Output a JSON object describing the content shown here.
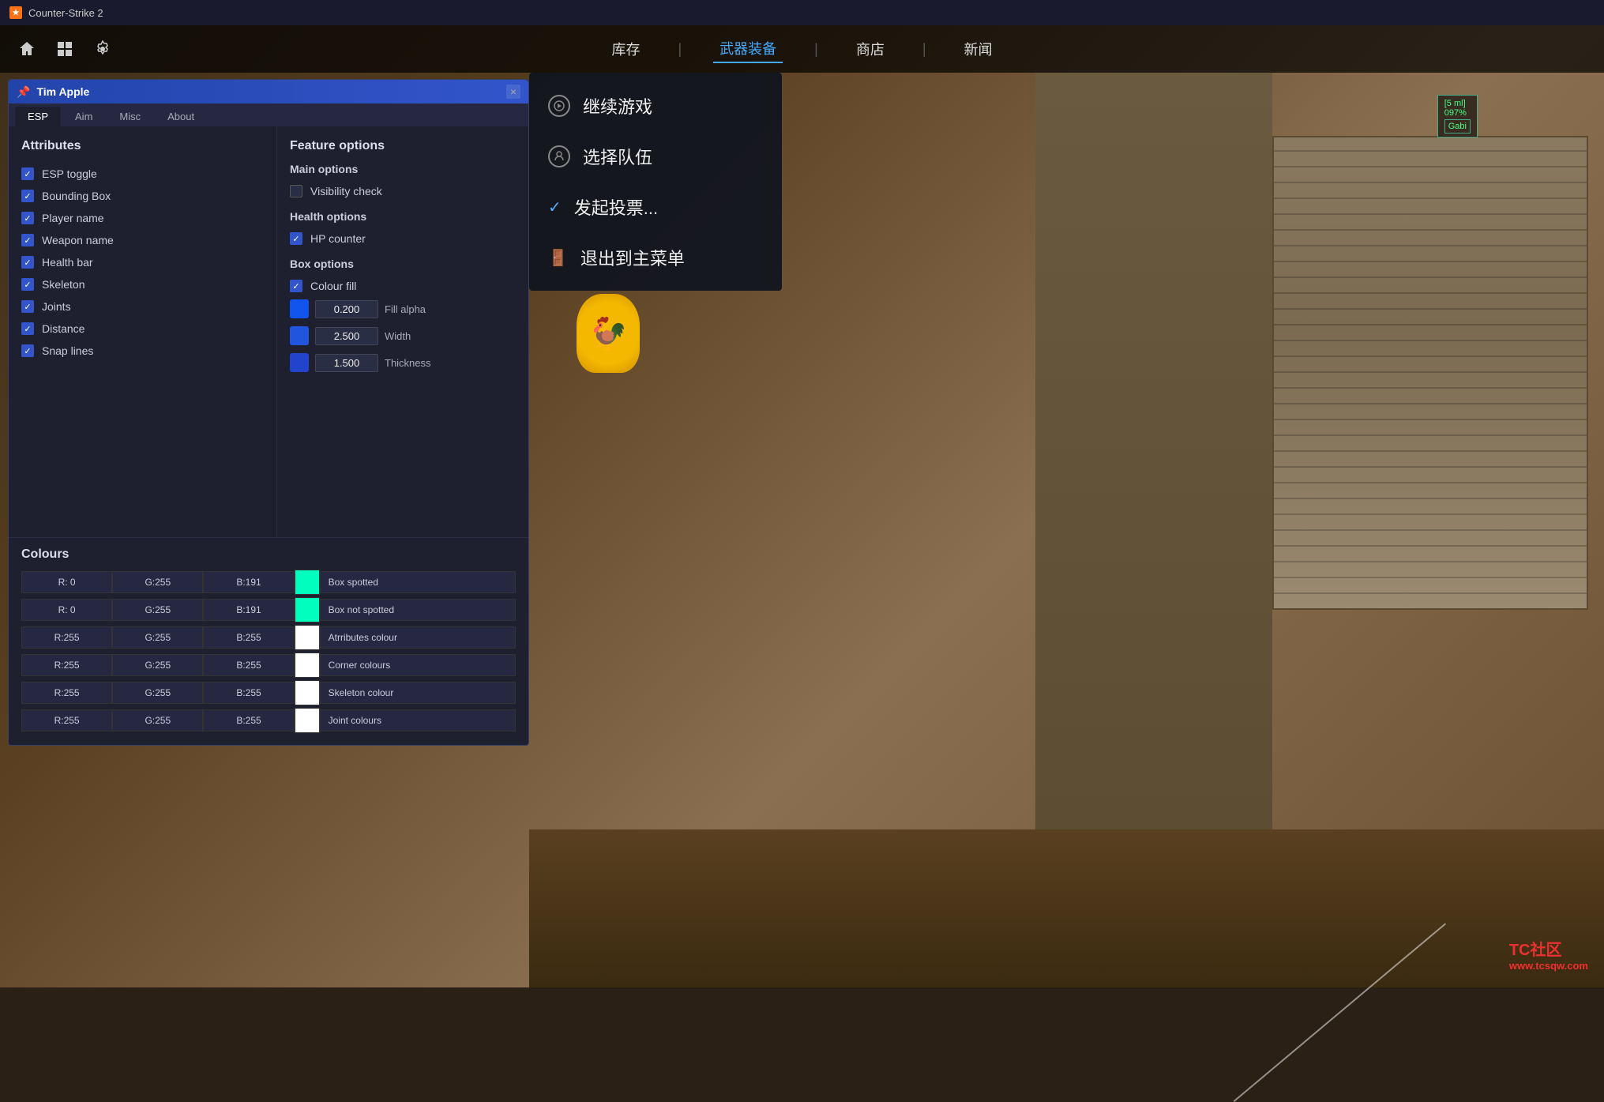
{
  "titlebar": {
    "title": "Counter-Strike 2"
  },
  "topnav": {
    "home_icon": "⌂",
    "inventory_icon": "⊞",
    "gear_icon": "⚙",
    "items": [
      "库存",
      "武器装备",
      "商店",
      "新闻"
    ]
  },
  "menu": {
    "items": [
      {
        "icon": "circle",
        "text": "继续游戏"
      },
      {
        "icon": "refresh",
        "text": "选择队伍"
      },
      {
        "icon": "check",
        "text": "发起投票..."
      },
      {
        "icon": "door",
        "text": "退出到主菜单"
      }
    ]
  },
  "cheat_panel": {
    "title": "Tim Apple",
    "pin_icon": "📌",
    "close_icon": "×",
    "tabs": [
      "ESP",
      "Aim",
      "Misc",
      "About"
    ],
    "active_tab": "ESP",
    "attributes": {
      "title": "Attributes",
      "items": [
        {
          "label": "ESP toggle",
          "checked": true
        },
        {
          "label": "Bounding Box",
          "checked": true
        },
        {
          "label": "Player name",
          "checked": true
        },
        {
          "label": "Weapon name",
          "checked": true
        },
        {
          "label": "Health bar",
          "checked": true
        },
        {
          "label": "Skeleton",
          "checked": true
        },
        {
          "label": "Joints",
          "checked": true
        },
        {
          "label": "Distance",
          "checked": true
        },
        {
          "label": "Snap lines",
          "checked": true
        }
      ]
    },
    "feature_options": {
      "title": "Feature options",
      "main_options": {
        "title": "Main options",
        "visibility_check": {
          "label": "Visibility check",
          "checked": false
        }
      },
      "health_options": {
        "title": "Health options",
        "hp_counter": {
          "label": "HP counter",
          "checked": true
        }
      },
      "box_options": {
        "title": "Box options",
        "colour_fill": {
          "label": "Colour fill",
          "checked": true
        },
        "sliders": [
          {
            "color": "#1155ee",
            "value": "0.200",
            "label": "Fill alpha"
          },
          {
            "color": "#2255dd",
            "value": "2.500",
            "label": "Width"
          },
          {
            "color": "#2244cc",
            "value": "1.500",
            "label": "Thickness"
          }
        ]
      }
    },
    "colours": {
      "title": "Colours",
      "rows": [
        {
          "r": "R: 0",
          "g": "G:255",
          "b": "B:191",
          "swatch": "#00ffbf",
          "label": "Box spotted"
        },
        {
          "r": "R: 0",
          "g": "G:255",
          "b": "B:191",
          "swatch": "#00ffbf",
          "label": "Box not spotted"
        },
        {
          "r": "R:255",
          "g": "G:255",
          "b": "B:255",
          "swatch": "#ffffff",
          "label": "Atrributes colour"
        },
        {
          "r": "R:255",
          "g": "G:255",
          "b": "B:255",
          "swatch": "#ffffff",
          "label": "Corner colours"
        },
        {
          "r": "R:255",
          "g": "G:255",
          "b": "B:255",
          "swatch": "#ffffff",
          "label": "Skeleton colour"
        },
        {
          "r": "R:255",
          "g": "G:255",
          "b": "B:255",
          "swatch": "#ffffff",
          "label": "Joint colours"
        }
      ]
    }
  },
  "watermark": {
    "brand": "TC社区",
    "url": "www.tcsqw.com"
  },
  "hud": {
    "text1": "[5 ml]",
    "text2": "097%",
    "player": "Gabi"
  }
}
